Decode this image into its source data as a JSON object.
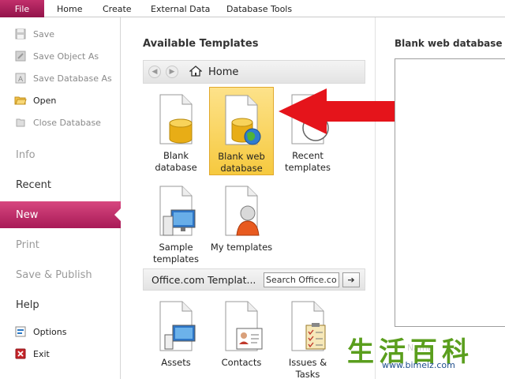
{
  "ribbon": {
    "tabs": [
      "File",
      "Home",
      "Create",
      "External Data",
      "Database Tools"
    ]
  },
  "left": {
    "commands": [
      {
        "label": "Save",
        "icon": "save-icon",
        "enabled": false
      },
      {
        "label": "Save Object As",
        "icon": "save-object-as-icon",
        "enabled": false
      },
      {
        "label": "Save Database As",
        "icon": "save-database-as-icon",
        "enabled": false
      },
      {
        "label": "Open",
        "icon": "open-folder-icon",
        "enabled": true
      },
      {
        "label": "Close Database",
        "icon": "close-database-icon",
        "enabled": false
      }
    ],
    "nav": [
      {
        "label": "Info",
        "state": "dim"
      },
      {
        "label": "Recent",
        "state": "normal"
      },
      {
        "label": "New",
        "state": "active"
      },
      {
        "label": "Print",
        "state": "dim"
      },
      {
        "label": "Save & Publish",
        "state": "dim"
      },
      {
        "label": "Help",
        "state": "normal"
      }
    ],
    "bottom": [
      {
        "label": "Options",
        "icon": "options-icon"
      },
      {
        "label": "Exit",
        "icon": "exit-icon"
      }
    ]
  },
  "middle": {
    "title": "Available Templates",
    "breadcrumb": "Home",
    "templates": [
      {
        "label1": "Blank",
        "label2": "database",
        "icon": "blank-database-icon"
      },
      {
        "label1": "Blank web",
        "label2": "database",
        "icon": "blank-web-database-icon",
        "selected": true
      },
      {
        "label1": "Recent",
        "label2": "templates",
        "icon": "recent-templates-icon"
      },
      {
        "label1": "Sample",
        "label2": "templates",
        "icon": "sample-templates-icon"
      },
      {
        "label1": "My templates",
        "label2": "",
        "icon": "my-templates-icon"
      }
    ],
    "office": {
      "title": "Office.com Templat...",
      "search_value": "Search Office.com"
    },
    "office_templates": [
      {
        "label1": "Assets",
        "label2": "",
        "icon": "assets-icon"
      },
      {
        "label1": "Contacts",
        "label2": "",
        "icon": "contacts-icon"
      },
      {
        "label1": "Issues &",
        "label2": "Tasks",
        "icon": "issues-tasks-icon"
      }
    ]
  },
  "right": {
    "title": "Blank web database",
    "faded_label": "Name"
  },
  "watermark": {
    "chars": "生活百科",
    "url": "www.bimeiz.com"
  },
  "colors": {
    "file_tab": "#a81a57",
    "arrow": "#e5141b",
    "selected_tile": "#f6c93f"
  }
}
